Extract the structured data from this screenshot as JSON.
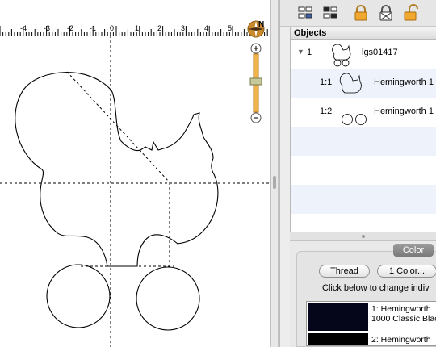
{
  "ruler": {
    "ticks": [
      "-4",
      "-3",
      "-2",
      "-1",
      "0",
      "1",
      "2",
      "3",
      "4",
      "5"
    ]
  },
  "compass": {
    "north_label": "N"
  },
  "toolbar": {
    "buttons": [
      "group-objects",
      "ungroup-objects",
      "lock",
      "lock-toggle",
      "unlock"
    ]
  },
  "objects": {
    "header": "Objects",
    "rows": [
      {
        "number": "1",
        "name": "lgs01417"
      },
      {
        "number": "1:1",
        "name": "Hemingworth 1"
      },
      {
        "number": "1:2",
        "name": "Hemingworth 1"
      }
    ]
  },
  "color_panel": {
    "tab_label": "Color",
    "thread_button": "Thread",
    "colors_button": "1 Color...",
    "hint": "Click below to change indiv",
    "swatches": [
      {
        "line1": "1: Hemingworth",
        "line2": "1000 Classic Blac",
        "color": "#06061a"
      },
      {
        "line1": "2: Hemingworth",
        "line2": "",
        "color": "#000000"
      }
    ]
  },
  "colors": {
    "canvas": "#ffffff",
    "panel": "#ececec",
    "selection_alt": "#eef3fb",
    "zoom_bar": "#e6a23c"
  }
}
